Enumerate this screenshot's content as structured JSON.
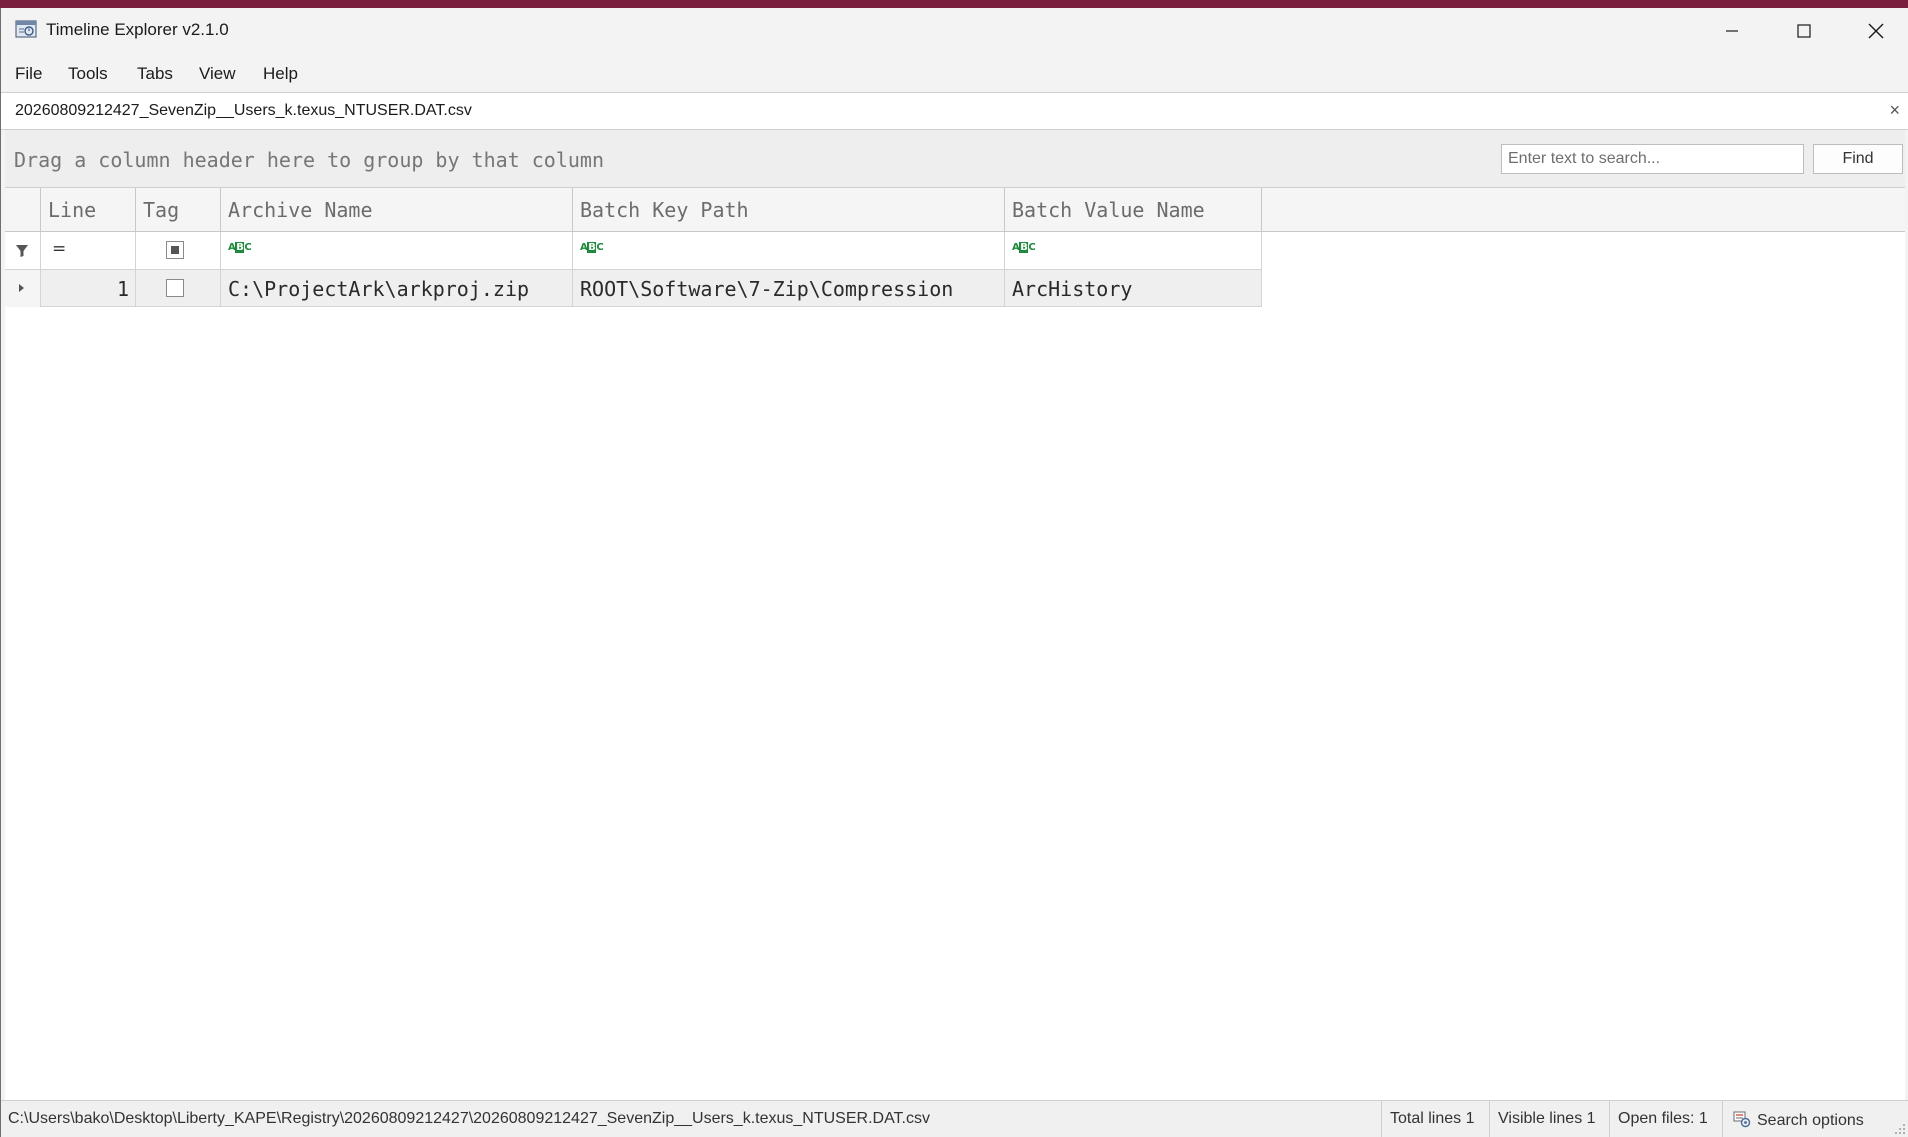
{
  "window": {
    "title": "Timeline Explorer v2.1.0"
  },
  "menu": {
    "items": [
      "File",
      "Tools",
      "Tabs",
      "View",
      "Help"
    ]
  },
  "tab": {
    "label": "20260809212427_SevenZip__Users_k.texus_NTUSER.DAT.csv",
    "close_glyph": "×"
  },
  "group_panel": {
    "hint": "Drag a column header here to group by that column"
  },
  "search": {
    "placeholder": "Enter text to search...",
    "find_label": "Find"
  },
  "grid": {
    "columns": [
      "Line",
      "Tag",
      "Archive Name",
      "Batch Key Path",
      "Batch Value Name"
    ],
    "filter": {
      "line_operator": "=",
      "text_filter_icon": "abc-text-filter-icon"
    },
    "rows": [
      {
        "line": "1",
        "tag": false,
        "archive_name": "C:\\ProjectArk\\arkproj.zip",
        "batch_key_path": "ROOT\\Software\\7-Zip\\Compression",
        "batch_value_name": "ArcHistory"
      }
    ]
  },
  "status": {
    "path": "C:\\Users\\bako\\Desktop\\Liberty_KAPE\\Registry\\20260809212427\\20260809212427_SevenZip__Users_k.texus_NTUSER.DAT.csv",
    "total_lines": "Total lines 1",
    "visible_lines": "Visible lines 1",
    "open_files": "Open files: 1",
    "search_options": "Search options"
  }
}
